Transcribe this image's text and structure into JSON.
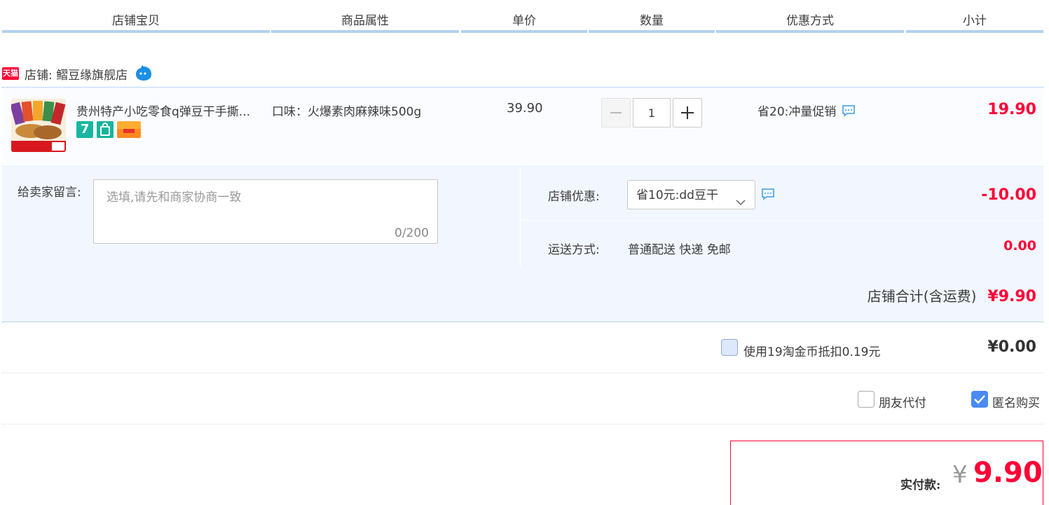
{
  "columns": [
    "店铺宝贝",
    "商品属性",
    "单价",
    "数量",
    "优惠方式",
    "小计"
  ],
  "shop": {
    "badge": "天猫",
    "label": "店铺: 鳛豆缘旗舰店"
  },
  "item": {
    "title": "贵州特产小吃零食q弹豆干手撕...",
    "attribute": "口味：火爆素肉麻辣味500g",
    "price": "39.90",
    "quantity": "1",
    "promotion": "省20:冲量促销",
    "subtotal": "19.90",
    "badge_seven": "7"
  },
  "message": {
    "label": "给卖家留言:",
    "placeholder": "选填,请先和商家协商一致",
    "counter": "0/200"
  },
  "coupon": {
    "label": "店铺优惠:",
    "selected": "省10元:dd豆干",
    "value": "-10.00"
  },
  "shipping": {
    "label": "运送方式:",
    "method": "普通配送 快递 免邮",
    "cost": "0.00"
  },
  "shop_total": {
    "label": "店铺合计(含运费)",
    "amount": "¥9.90"
  },
  "coins": {
    "text": "使用19淘金币抵扣0.19元",
    "amount": "¥0.00",
    "checked": false
  },
  "options": {
    "friend_pay": "朋友代付",
    "anonymous": "匿名购买",
    "anonymous_checked": true
  },
  "payment": {
    "label": "实付款:",
    "symbol": "¥",
    "amount": "9.90"
  },
  "colors": {
    "accent": "#ff0036",
    "header_line": "#b2d1ee",
    "panel_bg": "#f2f7ff"
  }
}
